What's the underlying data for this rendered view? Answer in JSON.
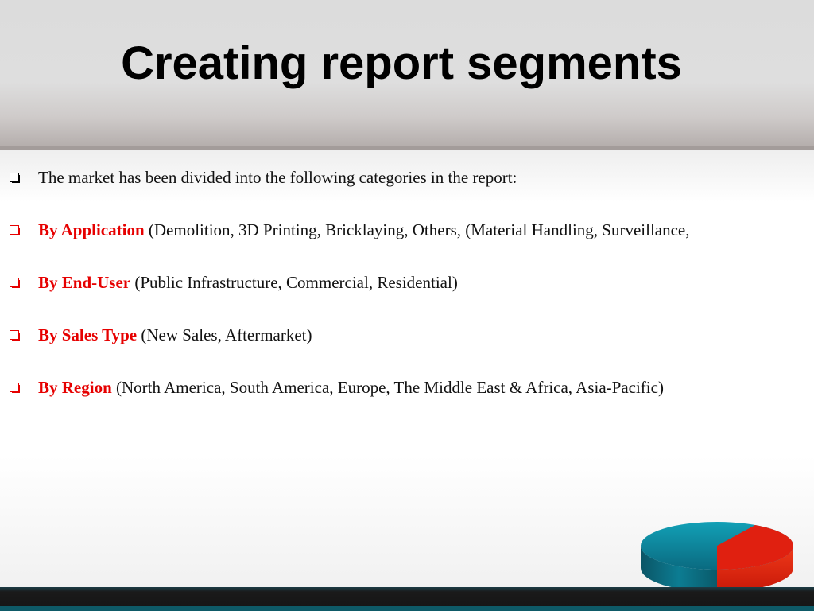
{
  "slide": {
    "title": "Creating report segments",
    "bullets": [
      {
        "label": "",
        "text": "The market has been divided into the following categories in the report:",
        "marker_color": "#000000"
      },
      {
        "label": "By Application",
        "text": " (Demolition, 3D Printing, Bricklaying, Others, (Material Handling, Surveillance,",
        "marker_color": "#e60000"
      },
      {
        "label": "By End-User",
        "text": " (Public Infrastructure, Commercial, Residential)",
        "marker_color": "#e60000"
      },
      {
        "label": "By Sales Type",
        "text": " (New Sales, Aftermarket)",
        "marker_color": "#e60000"
      },
      {
        "label": "By Region",
        "text": " (North America, South America, Europe, The Middle East & Africa, Asia-Pacific)",
        "marker_color": "#e60000"
      }
    ]
  },
  "colors": {
    "accent_red": "#e60000",
    "footer_teal": "#0e5a67",
    "pie_teal": "#0a6a80",
    "pie_red": "#e02010"
  },
  "icons": {
    "decoration": "pie-chart-icon"
  }
}
